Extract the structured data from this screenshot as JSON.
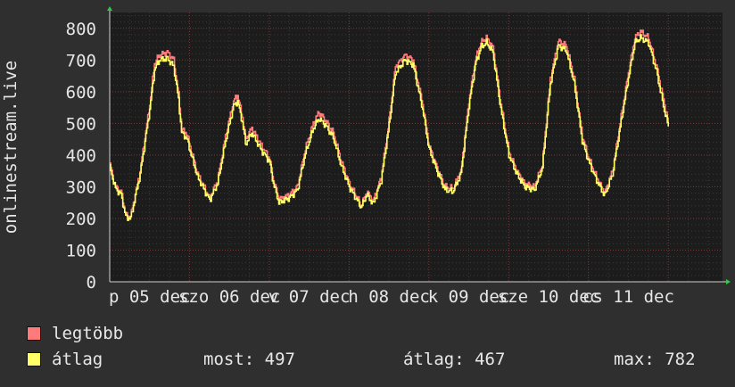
{
  "chart_data": {
    "type": "line",
    "ylabel": "onlinestream.live",
    "ylim": [
      0,
      850
    ],
    "yticks": [
      0,
      100,
      200,
      300,
      400,
      500,
      600,
      700,
      800
    ],
    "xlim": [
      0,
      7.68
    ],
    "xticks": [
      {
        "pos": 0.5,
        "label": "p 05 dec"
      },
      {
        "pos": 1.5,
        "label": "szo 06 dec"
      },
      {
        "pos": 2.5,
        "label": "v 07 dec"
      },
      {
        "pos": 3.5,
        "label": "h 08 dec"
      },
      {
        "pos": 4.5,
        "label": "k 09 dec"
      },
      {
        "pos": 5.5,
        "label": "sze 10 dec"
      },
      {
        "pos": 6.5,
        "label": "cs 11 dec"
      }
    ],
    "grid": true,
    "series": [
      {
        "name": "legtöbb",
        "color": "#ff7b7b",
        "keypoints": [
          [
            0,
            370
          ],
          [
            0.07,
            300
          ],
          [
            0.14,
            285
          ],
          [
            0.2,
            210
          ],
          [
            0.26,
            205
          ],
          [
            0.38,
            350
          ],
          [
            0.5,
            560
          ],
          [
            0.56,
            690
          ],
          [
            0.62,
            715
          ],
          [
            0.72,
            725
          ],
          [
            0.8,
            700
          ],
          [
            0.86,
            590
          ],
          [
            0.9,
            480
          ],
          [
            0.96,
            470
          ],
          [
            1.1,
            340
          ],
          [
            1.25,
            265
          ],
          [
            1.35,
            320
          ],
          [
            1.45,
            460
          ],
          [
            1.55,
            570
          ],
          [
            1.6,
            590
          ],
          [
            1.66,
            520
          ],
          [
            1.7,
            450
          ],
          [
            1.78,
            485
          ],
          [
            1.9,
            430
          ],
          [
            2.0,
            390
          ],
          [
            2.05,
            320
          ],
          [
            2.12,
            260
          ],
          [
            2.25,
            275
          ],
          [
            2.35,
            300
          ],
          [
            2.45,
            420
          ],
          [
            2.55,
            500
          ],
          [
            2.62,
            535
          ],
          [
            2.7,
            510
          ],
          [
            2.8,
            470
          ],
          [
            2.9,
            380
          ],
          [
            3.0,
            310
          ],
          [
            3.08,
            275
          ],
          [
            3.15,
            240
          ],
          [
            3.22,
            285
          ],
          [
            3.3,
            255
          ],
          [
            3.4,
            330
          ],
          [
            3.5,
            510
          ],
          [
            3.58,
            680
          ],
          [
            3.7,
            715
          ],
          [
            3.8,
            700
          ],
          [
            3.92,
            560
          ],
          [
            4.0,
            430
          ],
          [
            4.1,
            360
          ],
          [
            4.2,
            300
          ],
          [
            4.3,
            295
          ],
          [
            4.4,
            350
          ],
          [
            4.5,
            570
          ],
          [
            4.58,
            700
          ],
          [
            4.65,
            755
          ],
          [
            4.72,
            770
          ],
          [
            4.8,
            740
          ],
          [
            4.9,
            560
          ],
          [
            5.0,
            410
          ],
          [
            5.1,
            350
          ],
          [
            5.2,
            310
          ],
          [
            5.32,
            300
          ],
          [
            5.42,
            370
          ],
          [
            5.52,
            640
          ],
          [
            5.62,
            760
          ],
          [
            5.72,
            745
          ],
          [
            5.82,
            640
          ],
          [
            5.92,
            460
          ],
          [
            6.0,
            390
          ],
          [
            6.1,
            330
          ],
          [
            6.2,
            280
          ],
          [
            6.3,
            350
          ],
          [
            6.42,
            540
          ],
          [
            6.5,
            660
          ],
          [
            6.58,
            770
          ],
          [
            6.65,
            790
          ],
          [
            6.75,
            770
          ],
          [
            6.85,
            680
          ],
          [
            6.95,
            560
          ],
          [
            7.0,
            500
          ]
        ]
      },
      {
        "name": "átlag",
        "color": "#ffff66",
        "keypoints": [
          [
            0,
            360
          ],
          [
            0.07,
            295
          ],
          [
            0.14,
            275
          ],
          [
            0.2,
            205
          ],
          [
            0.26,
            200
          ],
          [
            0.38,
            340
          ],
          [
            0.5,
            545
          ],
          [
            0.56,
            670
          ],
          [
            0.62,
            700
          ],
          [
            0.72,
            705
          ],
          [
            0.8,
            680
          ],
          [
            0.86,
            575
          ],
          [
            0.9,
            470
          ],
          [
            0.96,
            455
          ],
          [
            1.1,
            330
          ],
          [
            1.25,
            258
          ],
          [
            1.35,
            310
          ],
          [
            1.45,
            445
          ],
          [
            1.55,
            555
          ],
          [
            1.6,
            570
          ],
          [
            1.66,
            505
          ],
          [
            1.7,
            435
          ],
          [
            1.78,
            470
          ],
          [
            1.9,
            415
          ],
          [
            2.0,
            380
          ],
          [
            2.05,
            310
          ],
          [
            2.12,
            250
          ],
          [
            2.25,
            265
          ],
          [
            2.35,
            290
          ],
          [
            2.45,
            405
          ],
          [
            2.55,
            485
          ],
          [
            2.62,
            515
          ],
          [
            2.7,
            495
          ],
          [
            2.8,
            455
          ],
          [
            2.9,
            365
          ],
          [
            3.0,
            300
          ],
          [
            3.08,
            265
          ],
          [
            3.15,
            235
          ],
          [
            3.22,
            275
          ],
          [
            3.3,
            245
          ],
          [
            3.4,
            320
          ],
          [
            3.5,
            495
          ],
          [
            3.58,
            660
          ],
          [
            3.7,
            700
          ],
          [
            3.8,
            685
          ],
          [
            3.92,
            545
          ],
          [
            4.0,
            420
          ],
          [
            4.1,
            350
          ],
          [
            4.2,
            290
          ],
          [
            4.3,
            285
          ],
          [
            4.4,
            340
          ],
          [
            4.5,
            555
          ],
          [
            4.58,
            685
          ],
          [
            4.65,
            740
          ],
          [
            4.72,
            755
          ],
          [
            4.8,
            725
          ],
          [
            4.9,
            545
          ],
          [
            5.0,
            400
          ],
          [
            5.1,
            340
          ],
          [
            5.2,
            300
          ],
          [
            5.32,
            290
          ],
          [
            5.42,
            360
          ],
          [
            5.52,
            625
          ],
          [
            5.62,
            745
          ],
          [
            5.72,
            730
          ],
          [
            5.82,
            625
          ],
          [
            5.92,
            445
          ],
          [
            6.0,
            380
          ],
          [
            6.1,
            320
          ],
          [
            6.2,
            272
          ],
          [
            6.3,
            340
          ],
          [
            6.42,
            525
          ],
          [
            6.5,
            645
          ],
          [
            6.58,
            755
          ],
          [
            6.65,
            770
          ],
          [
            6.75,
            755
          ],
          [
            6.85,
            665
          ],
          [
            6.95,
            540
          ],
          [
            7.0,
            490
          ]
        ]
      }
    ]
  },
  "legend": {
    "items": [
      {
        "label": "legtöbb",
        "color": "#ff7b7b"
      },
      {
        "label": "átlag",
        "color": "#ffff66"
      }
    ],
    "stats": {
      "now": "most: 497",
      "avg": "átlag: 467",
      "max": "max: 782"
    }
  }
}
